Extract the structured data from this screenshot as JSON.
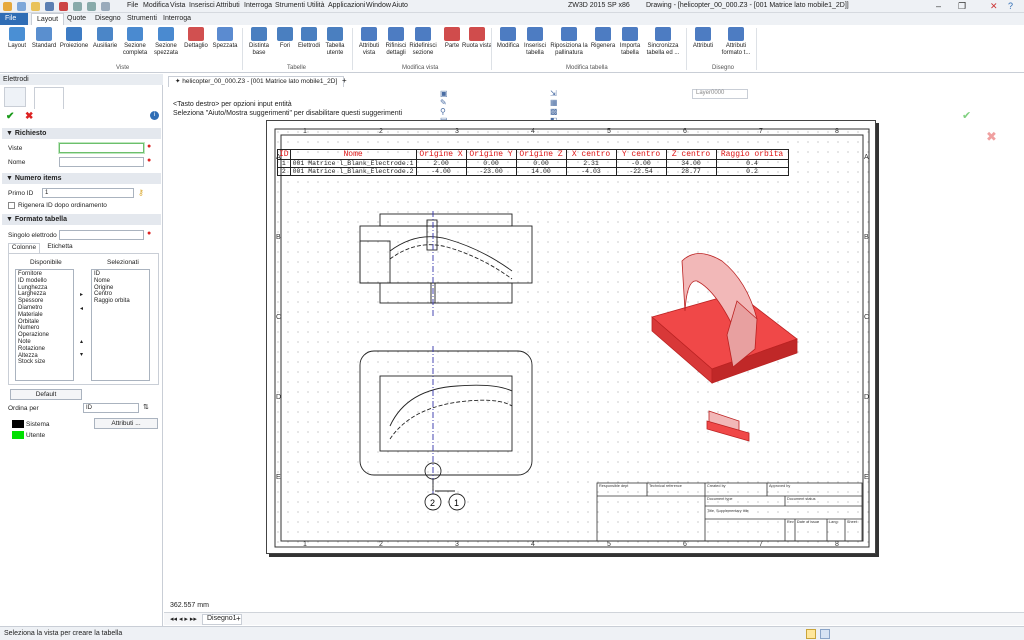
{
  "titlebar": {
    "app": "ZW3D 2015 SP x86",
    "doc": "Drawing - [helicopter_00_000.Z3 - [001 Matrice lato mobile1_2D]]",
    "menus": [
      "File",
      "Modifica",
      "Vista",
      "Inserisci",
      "Attributi",
      "Interroga",
      "Strumenti",
      "Utilità",
      "Applicazioni",
      "Window",
      "Aiuto"
    ]
  },
  "ribbon": {
    "tabs": [
      "File",
      "Layout",
      "Quote",
      "Disegno",
      "Strumenti",
      "Interroga"
    ],
    "groups": [
      {
        "label": "Viste",
        "buttons": [
          "Layout",
          "Standard",
          "Proiezione",
          "Ausiliarie",
          "Sezione completa",
          "Sezione spezzata",
          "Dettaglio",
          "Spezzata"
        ]
      },
      {
        "label": "Tabelle",
        "buttons": [
          "Distinta base",
          "Fori",
          "Elettrodi",
          "Tabella utente"
        ]
      },
      {
        "label": "Modifica vista",
        "buttons": [
          "Attributi vista",
          "Rifinisci dettagli",
          "Ridefinisci sezione",
          "Parte",
          "Ruota vista"
        ]
      },
      {
        "label": "Modifica tabella",
        "buttons": [
          "Modifica",
          "Inserisci tabella",
          "Riposiziona la pallinatura",
          "Rigenera",
          "Importa tabella",
          "Sincronizza tabella ed ..."
        ]
      },
      {
        "label": "Disegno",
        "buttons": [
          "Attributi",
          "Attributi formato t..."
        ]
      }
    ]
  },
  "panel": {
    "title": "Elettrodi",
    "richiesto": "Richiesto",
    "viste_label": "Viste",
    "viste_value": "",
    "nome_label": "Nome",
    "nome_value": "",
    "numero_items": "Numero items",
    "primo_id_label": "Primo ID",
    "primo_id_value": "1",
    "rigenera": "Rigenera ID dopo ordinamento",
    "formato_tabella": "Formato tabella",
    "singolo": "Singolo elettrodo",
    "tab_colonne": "Colonne",
    "tab_etichetta": "Etichetta",
    "disponibile": "Disponibile",
    "selezionati": "Selezionati",
    "available": [
      "Fornitore",
      "ID modello",
      "Lunghezza",
      "Larghezza",
      "Spessore",
      "Diametro",
      "Materiale",
      "Orbitale",
      "Numero",
      "Operazione",
      "Note",
      "Rotazione",
      "Altezza",
      "Stock size"
    ],
    "selected": [
      "ID",
      "Nome",
      "Origine",
      "Centro",
      "Raggio orbita"
    ],
    "default_btn": "Default",
    "ordina_label": "Ordina per",
    "ordina_value": "ID",
    "sistema": "Sistema",
    "utente": "Utente",
    "attributi_btn": "Attributi ...",
    "sistema_color": "#000000",
    "utente_color": "#00e000"
  },
  "document": {
    "tab": "helicopter_00_000.Z3 - [001 Matrice lato mobile1_2D]",
    "layer": "Layer0000",
    "hint1": "<Tasto destro> per opzioni input entità",
    "hint2": "Seleziona \"Aiuto/Mostra suggerimenti\" per disabilitare questi suggerimenti",
    "coord": "362.557 mm",
    "sheet_tab": "Disegno1"
  },
  "table": {
    "headers": [
      "ID",
      "Nome",
      "Origine X",
      "Origine Y",
      "Origine Z",
      "X centro",
      "Y centro",
      "Z centro",
      "Raggio orbita"
    ],
    "rows": [
      [
        "1",
        "001 Matrice l_Blank_Electrode.1",
        "2.00",
        "0.00",
        "0.00",
        "2.31",
        "-0.00",
        "34.00",
        "0.4"
      ],
      [
        "2",
        "001 Matrice l_Blank_Electrode.2",
        "-4.00",
        "-23.00",
        "14.00",
        "-4.03",
        "-22.54",
        "28.77",
        "0.2"
      ]
    ]
  },
  "frame": {
    "cols": [
      "1",
      "2",
      "3",
      "4",
      "5",
      "6",
      "7",
      "8"
    ],
    "rows": [
      "A",
      "B",
      "C",
      "D",
      "E"
    ]
  },
  "balloons": [
    "2",
    "1"
  ],
  "titleblock": [
    "Responsible dept",
    "Technical reference",
    "Created by",
    "Approved by",
    "Document type",
    "Document status",
    "Title, Supplementary title",
    "Rev",
    "Date of issue",
    "Lang",
    "Sheet"
  ],
  "status": "Seleziona la vista per creare la tabella"
}
